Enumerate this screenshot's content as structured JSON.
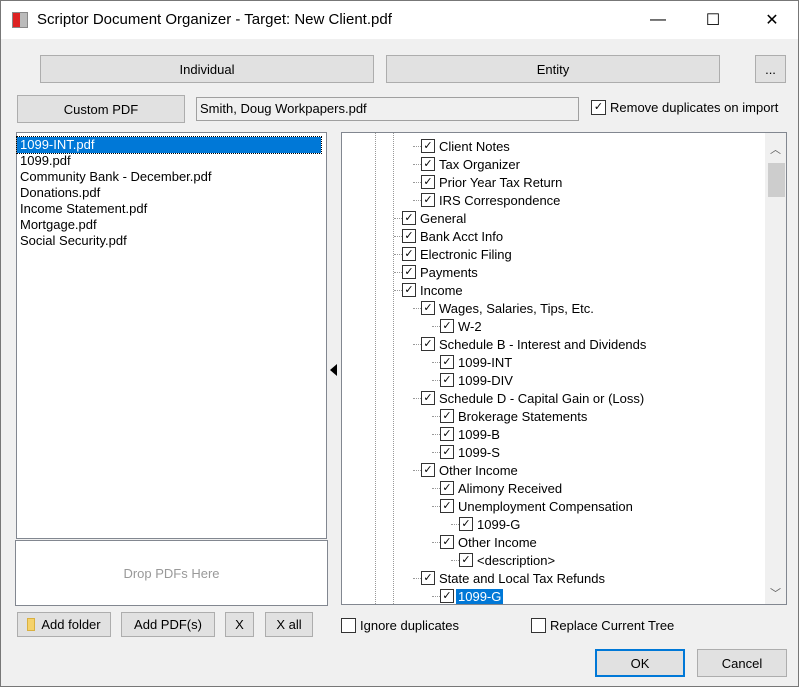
{
  "window": {
    "title": "Scriptor Document Organizer - Target: New Client.pdf",
    "minimize": "—",
    "maximize": "☐",
    "close": "✕"
  },
  "top": {
    "individual": "Individual",
    "entity": "Entity",
    "more": "..."
  },
  "custom": {
    "button": "Custom PDF",
    "filename": "Smith, Doug Workpapers.pdf",
    "remove_dup_label": "Remove duplicates on import",
    "remove_dup_checked": true
  },
  "files": [
    "1099-INT.pdf",
    "1099.pdf",
    "Community Bank - December.pdf",
    "Donations.pdf",
    "Income Statement.pdf",
    "Mortgage.pdf",
    "Social Security.pdf"
  ],
  "selected_file": "1099-INT.pdf",
  "drop_zone": "Drop PDFs Here",
  "tree": [
    {
      "label": "Client Notes",
      "level": 1,
      "checked": true
    },
    {
      "label": "Tax Organizer",
      "level": 1,
      "checked": true
    },
    {
      "label": "Prior Year Tax Return",
      "level": 1,
      "checked": true
    },
    {
      "label": "IRS Correspondence",
      "level": 1,
      "checked": true
    },
    {
      "label": "General",
      "level": 0,
      "checked": true
    },
    {
      "label": "Bank Acct Info",
      "level": 0,
      "checked": true
    },
    {
      "label": "Electronic Filing",
      "level": 0,
      "checked": true
    },
    {
      "label": "Payments",
      "level": 0,
      "checked": true
    },
    {
      "label": "Income",
      "level": 0,
      "checked": true
    },
    {
      "label": "Wages, Salaries, Tips, Etc.",
      "level": 1,
      "checked": true
    },
    {
      "label": "W-2",
      "level": 2,
      "checked": true
    },
    {
      "label": "Schedule B - Interest and Dividends",
      "level": 1,
      "checked": true
    },
    {
      "label": "1099-INT",
      "level": 2,
      "checked": true
    },
    {
      "label": "1099-DIV",
      "level": 2,
      "checked": true
    },
    {
      "label": "Schedule D - Capital Gain or (Loss)",
      "level": 1,
      "checked": true
    },
    {
      "label": "Brokerage Statements",
      "level": 2,
      "checked": true
    },
    {
      "label": "1099-B",
      "level": 2,
      "checked": true
    },
    {
      "label": "1099-S",
      "level": 2,
      "checked": true
    },
    {
      "label": "Other Income",
      "level": 1,
      "checked": true
    },
    {
      "label": "Alimony Received",
      "level": 2,
      "checked": true
    },
    {
      "label": "Unemployment Compensation",
      "level": 2,
      "checked": true
    },
    {
      "label": "1099-G",
      "level": 3,
      "checked": true
    },
    {
      "label": "Other Income",
      "level": 2,
      "checked": true
    },
    {
      "label": "<description>",
      "level": 3,
      "checked": true
    },
    {
      "label": "State and Local Tax Refunds",
      "level": 1,
      "checked": true
    },
    {
      "label": "1099-G",
      "level": 2,
      "checked": true,
      "selected": true
    }
  ],
  "bottom": {
    "add_folder": "Add folder",
    "add_pdfs": "Add PDF(s)",
    "remove": "X",
    "remove_all": "X all",
    "ignore_dup": "Ignore duplicates",
    "replace_tree": "Replace Current Tree",
    "ok": "OK",
    "cancel": "Cancel"
  },
  "colors": {
    "selection": "#0078d7",
    "folder": "#f5d26b"
  }
}
